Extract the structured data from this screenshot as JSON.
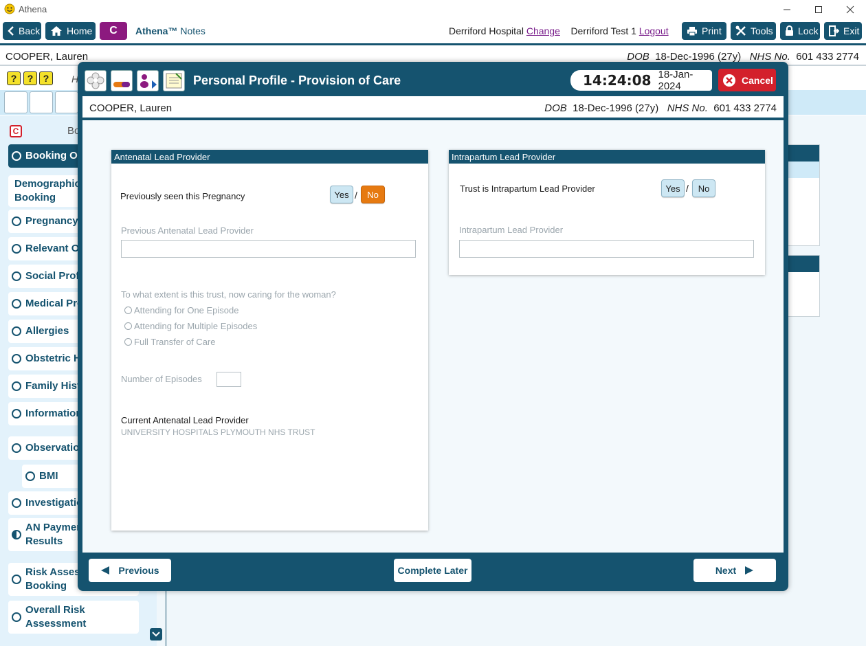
{
  "window": {
    "title": "Athena"
  },
  "toolbar": {
    "back": "Back",
    "home": "Home",
    "c_logo": "C",
    "brand_name": "Athena™",
    "brand_suffix": "Notes",
    "hospital": "Derriford Hospital",
    "change_link": "Change",
    "user": "Derriford Test 1",
    "logout_link": "Logout",
    "print": "Print",
    "tools": "Tools",
    "lock": "Lock",
    "exit": "Exit"
  },
  "patient": {
    "name": "COOPER, Lauren",
    "dob_label": "DOB",
    "dob": "18-Dec-1996 (27y)",
    "nhs_label": "NHS No.",
    "nhs": "601 433 2774"
  },
  "background": {
    "sub_label": "H",
    "section_label": "Bo",
    "nav_items": [
      {
        "label": "Booking Ov",
        "state": "active"
      },
      {
        "label": "Demographics\nBooking",
        "state": "none"
      },
      {
        "label": "Pregnancy I",
        "state": "empty"
      },
      {
        "label": "Relevant Ot",
        "state": "empty"
      },
      {
        "label": "Social Profil",
        "state": "empty"
      },
      {
        "label": "Medical Pro",
        "state": "empty"
      },
      {
        "label": "Allergies",
        "state": "empty"
      },
      {
        "label": "Obstetric H",
        "state": "empty"
      },
      {
        "label": "Family Histo",
        "state": "empty"
      },
      {
        "label": "Information",
        "state": "empty"
      },
      {
        "label": "Observation",
        "state": "empty"
      },
      {
        "label": "BMI",
        "state": "empty"
      },
      {
        "label": "Investigatio",
        "state": "empty"
      },
      {
        "label": "AN Paymen\nResults",
        "state": "half"
      },
      {
        "label": "Risk Assess\nBooking",
        "state": "empty"
      },
      {
        "label": "Overall Risk\nAssessment",
        "state": "empty"
      }
    ]
  },
  "modal": {
    "title": "Personal Profile - Provision of Care",
    "time": "14:24:08",
    "date": "18-Jan-2024",
    "cancel": "Cancel",
    "antenatal": {
      "heading": "Antenatal Lead Provider",
      "q_seen": "Previously seen this Pregnancy",
      "yes": "Yes",
      "sep": "/",
      "no": "No",
      "selected": "No",
      "prev_provider_label": "Previous Antenatal Lead Provider",
      "prev_provider_value": "",
      "extent_q": "To what extent is this trust, now caring for the woman?",
      "extent_options": [
        "Attending for One Episode",
        "Attending for Multiple Episodes",
        "Full Transfer of Care"
      ],
      "episodes_label": "Number of Episodes",
      "episodes_value": "",
      "current_label": "Current Antenatal Lead Provider",
      "current_value": "UNIVERSITY HOSPITALS PLYMOUTH NHS TRUST"
    },
    "intrapartum": {
      "heading": "Intrapartum Lead Provider",
      "q_trust": "Trust is Intrapartum Lead Provider",
      "yes": "Yes",
      "sep": "/",
      "no": "No",
      "selected": "",
      "provider_label": "Intrapartum Lead Provider",
      "provider_value": ""
    },
    "footer": {
      "previous": "Previous",
      "complete_later": "Complete Later",
      "next": "Next"
    }
  },
  "colors": {
    "primary": "#15536f",
    "accent_orange": "#e67a11",
    "cancel_red": "#d3202b",
    "brand_purple": "#8c1a7f"
  }
}
